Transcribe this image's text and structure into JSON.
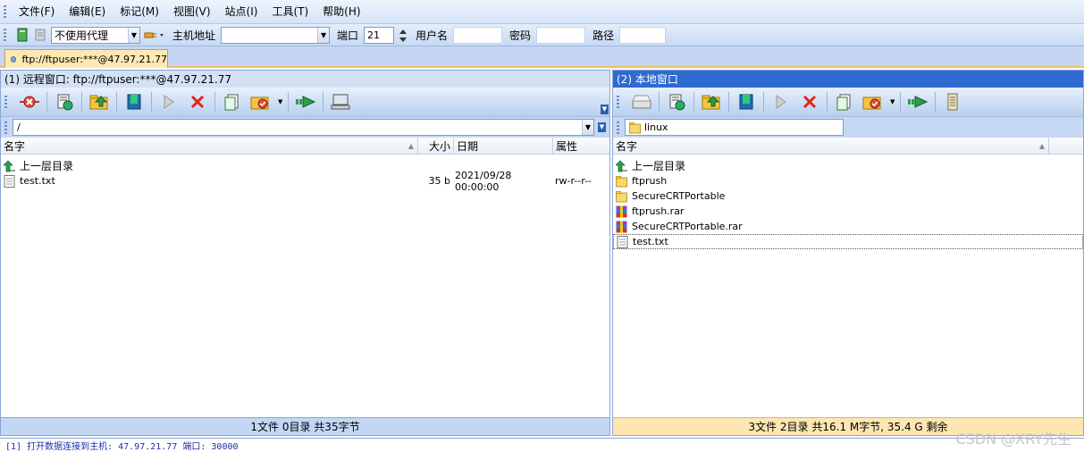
{
  "menu": [
    "文件(F)",
    "编辑(E)",
    "标记(M)",
    "视图(V)",
    "站点(I)",
    "工具(T)",
    "帮助(H)"
  ],
  "connection": {
    "proxy": "不使用代理",
    "host_label": "主机地址",
    "host_value": "",
    "port_label": "端口",
    "port_value": "21",
    "user_label": "用户名",
    "user_value": "",
    "password_label": "密码",
    "password_value": "",
    "path_label": "路径",
    "path_value": ""
  },
  "tab": {
    "label": "ftp://ftpuser:***@47.97.21.77"
  },
  "remote": {
    "title": "(1) 远程窗口: ftp://ftpuser:***@47.97.21.77",
    "path": "/",
    "columns": {
      "name": "名字",
      "size": "大小",
      "date": "日期",
      "attr": "属性"
    },
    "rows": [
      {
        "name": "上一层目录",
        "size": "",
        "date": "",
        "attr": "",
        "type": "up"
      },
      {
        "name": "test.txt",
        "size": "35 b",
        "date": "2021/09/28 00:00:00",
        "attr": "rw-r--r--",
        "type": "file"
      }
    ],
    "status": "1文件 0目录 共35字节"
  },
  "local": {
    "title": "(2) 本地窗口",
    "path": "linux",
    "columns": {
      "name": "名字"
    },
    "rows": [
      {
        "name": "上一层目录",
        "type": "up"
      },
      {
        "name": "ftprush",
        "type": "folder"
      },
      {
        "name": "SecureCRTPortable",
        "type": "folder"
      },
      {
        "name": "ftprush.rar",
        "type": "rar"
      },
      {
        "name": "SecureCRTPortable.rar",
        "type": "rar"
      },
      {
        "name": "test.txt",
        "type": "file"
      }
    ],
    "status": "3文件 2目录 共16.1 M字节, 35.4 G 剩余"
  },
  "log": "[1] 打开数据连接到主机: 47.97.21.77 端口: 30000",
  "watermark": "CSDN @XRY先生",
  "colors": {
    "accent": "#2f6ad0",
    "tab": "#fde9b3",
    "local_status": "#fde6b2",
    "remote_status": "#c3d7f5"
  }
}
